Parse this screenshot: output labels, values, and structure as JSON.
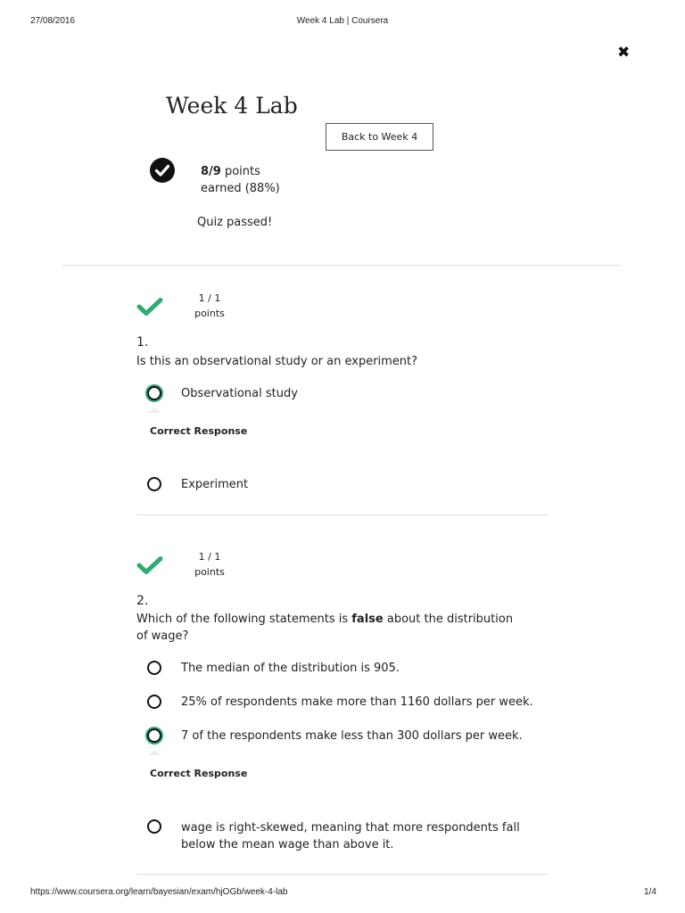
{
  "print_header": {
    "date": "27/08/2016",
    "page_title": "Week 4 Lab | Coursera"
  },
  "print_footer": {
    "url": "https://www.coursera.org/learn/bayesian/exam/hjOGb/week-4-lab",
    "page": "1/4"
  },
  "close_glyph": "✖",
  "title": "Week 4 Lab",
  "back_button": "Back to Week 4",
  "summary": {
    "score": "8/9",
    "points_word": " points",
    "earned": "earned (88%)",
    "message": "Quiz passed!"
  },
  "questions": [
    {
      "points": "1 / 1",
      "points_label": "points",
      "number": "1.",
      "text": "Is this an observational study or an experiment?",
      "options": [
        "Observational study",
        "Experiment"
      ],
      "selected_option": "Observational study",
      "feedback": "Correct Response"
    },
    {
      "points": "1 / 1",
      "points_label": "points",
      "number": "2.",
      "text_before": "Which of the following statements is ",
      "text_bold": "false",
      "text_after": " about the distribution of wage?",
      "options": [
        "The median of the distribution is 905.",
        "25% of respondents make more than 1160 dollars per week.",
        "7 of the respondents make less than 300 dollars per week.",
        "wage is right-skewed, meaning that more respondents fall below the mean wage than above it."
      ],
      "selected_option": "7 of the respondents make less than 300 dollars per week.",
      "feedback": "Correct Response"
    }
  ],
  "colors": {
    "correct_green": "#2eaa72",
    "text": "#222222",
    "divider": "#dddddd"
  }
}
